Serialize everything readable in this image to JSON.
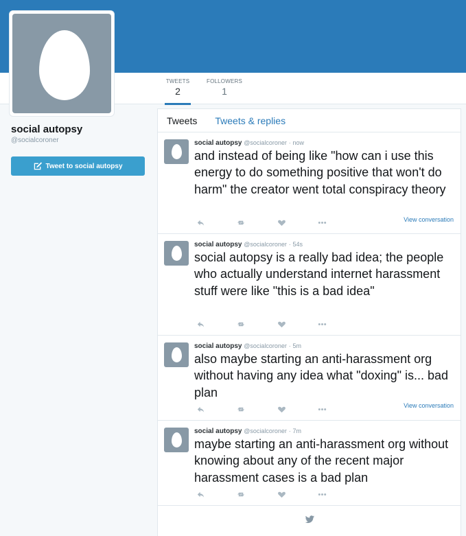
{
  "profile": {
    "name": "social autopsy",
    "handle": "@socialcoroner",
    "tweet_to_label": "Tweet to social autopsy"
  },
  "stats": [
    {
      "label": "TWEETS",
      "value": "2"
    },
    {
      "label": "FOLLOWERS",
      "value": "1"
    }
  ],
  "tabs": {
    "tweets": "Tweets",
    "replies": "Tweets & replies"
  },
  "tweets": [
    {
      "name": "social autopsy",
      "handle": "@socialcoroner",
      "time": "now",
      "text": "and instead of being like \"how can i use this energy to do something positive that won't do harm\" the creator went total conspiracy theory",
      "conversation": "View conversation"
    },
    {
      "name": "social autopsy",
      "handle": "@socialcoroner",
      "time": "54s",
      "text": "social autopsy is a really bad idea; the people who actually understand internet harassment stuff were like \"this is a bad idea\""
    },
    {
      "name": "social autopsy",
      "handle": "@socialcoroner",
      "time": "5m",
      "text": "also maybe starting an anti-harassment org without having any idea what \"doxing\" is... bad plan",
      "conversation": "View conversation"
    },
    {
      "name": "social autopsy",
      "handle": "@socialcoroner",
      "time": "7m",
      "text": "maybe starting an anti-harassment org without knowing about any of the recent major harassment cases is a bad plan"
    }
  ],
  "separator": "·",
  "colors": {
    "header": "#2b7bb9",
    "button": "#3a9fce",
    "link": "#2b7bb9",
    "avatar": "#8899a6"
  },
  "icons": [
    "reply-icon",
    "retweet-icon",
    "like-icon",
    "more-icon",
    "compose-icon",
    "bird-icon"
  ]
}
